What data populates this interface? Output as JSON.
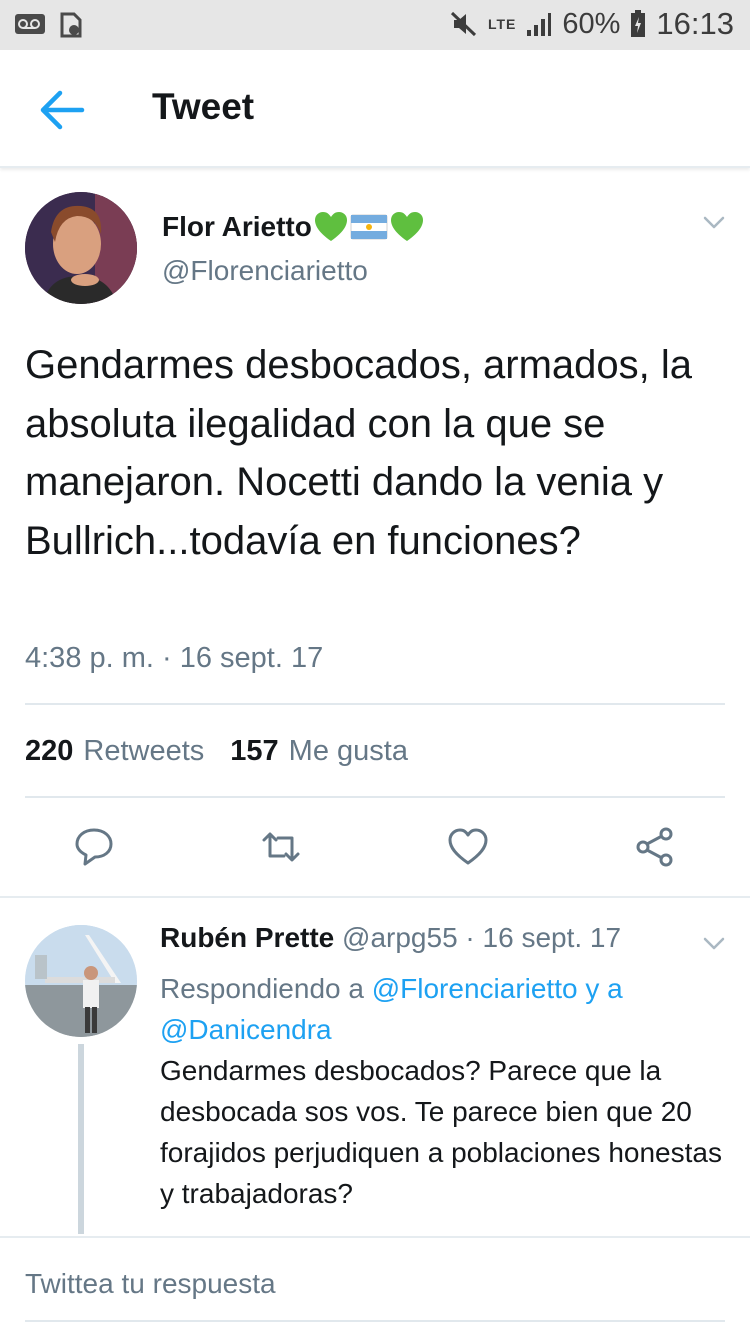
{
  "status_bar": {
    "network_label": "LTE",
    "battery_percent": "60%",
    "time": "16:13"
  },
  "header": {
    "title": "Tweet"
  },
  "tweet": {
    "author_name": "Flor Arietto",
    "author_handle": "@Florenciarietto",
    "text": "Gendarmes desbocados, armados, la absoluta ilegalidad con la que se manejaron. Nocetti dando la venia y Bullrich...todavía en funciones?",
    "timestamp": "4:38 p. m. · 16 sept. 17",
    "retweets_count": "220",
    "retweets_label": "Retweets",
    "likes_count": "157",
    "likes_label": "Me gusta"
  },
  "reply": {
    "author_name": "Rubén Prette",
    "meta": "@arpg55 · 16 sept. 17",
    "replying_prefix": "Respondiendo a",
    "mention_1": "@Florenciarietto",
    "mention_joiner": "y a",
    "mention_2": "@Danicendra",
    "text": "Gendarmes desbocados? Parece que la desbocada sos vos. Te parece bien que 20 forajidos perjudiquen a poblaciones honestas y trabajadoras?"
  },
  "compose": {
    "placeholder": "Twittea tu respuesta"
  },
  "colors": {
    "accent": "#1da1f2",
    "secondary_text": "#657786",
    "primary_text": "#14171a"
  },
  "icons": {
    "back": "arrow-left-icon",
    "reply": "speech-bubble-icon",
    "retweet": "retweet-icon",
    "like": "heart-icon",
    "share": "share-icon"
  }
}
